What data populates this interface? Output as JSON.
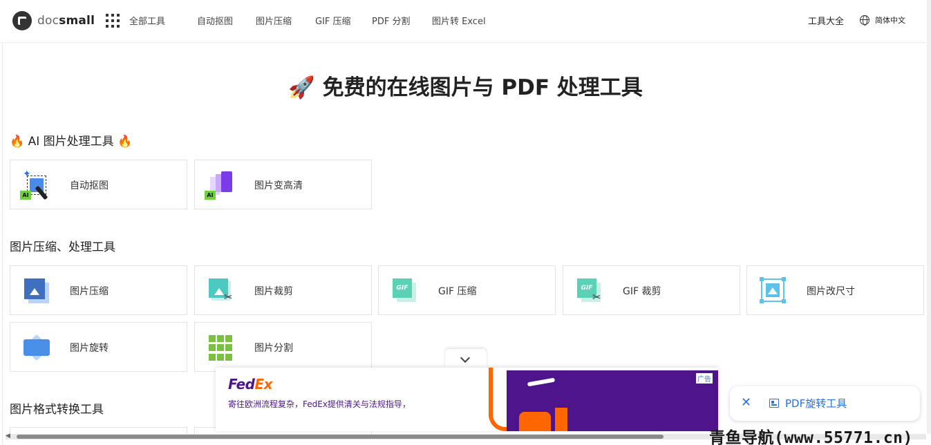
{
  "header": {
    "logo_doc": "doc",
    "logo_small": "small",
    "nav": [
      "全部工具",
      "自动抠图",
      "图片压缩",
      "GIF 压缩",
      "PDF 分割",
      "图片转 Excel"
    ],
    "tools_all": "工具大全",
    "language": "简体中文"
  },
  "hero": {
    "title": "🚀 免费的在线图片与 PDF 处理工具"
  },
  "sections": {
    "ai": "🔥 AI 图片处理工具 🔥",
    "compress": "图片压缩、处理工具",
    "convert": "图片格式转换工具"
  },
  "ai_tools": [
    {
      "label": "自动抠图",
      "icon": "cutout-icon"
    },
    {
      "label": "图片变高清",
      "icon": "upscale-icon"
    }
  ],
  "image_tools": [
    {
      "label": "图片压缩",
      "icon": "image-compress-icon"
    },
    {
      "label": "图片裁剪",
      "icon": "image-crop-icon"
    },
    {
      "label": "GIF 压缩",
      "icon": "gif-compress-icon"
    },
    {
      "label": "GIF 裁剪",
      "icon": "gif-crop-icon"
    },
    {
      "label": "图片改尺寸",
      "icon": "resize-icon"
    },
    {
      "label": "图片旋转",
      "icon": "rotate-icon"
    },
    {
      "label": "图片分割",
      "icon": "split-icon"
    }
  ],
  "ad": {
    "brand_fed": "Fed",
    "brand_ex": "Ex",
    "text": "寄往欧洲流程复杂，FedEx提供清关与法规指导，",
    "badge": "广告"
  },
  "floating": {
    "close": "✕",
    "label": "PDF旋转工具"
  },
  "watermark": "青鱼导航(www.55771.cn)",
  "colors": {
    "accent": "#2a6fe0",
    "fedex_purple": "#4d148c",
    "fedex_orange": "#ff6600"
  }
}
